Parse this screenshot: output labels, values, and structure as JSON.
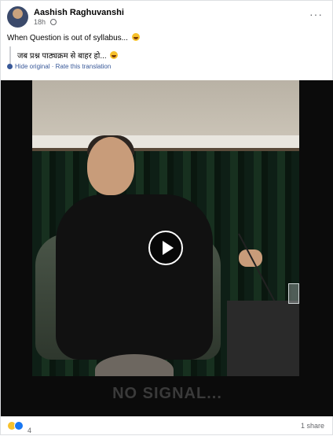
{
  "post": {
    "author": "Aashish Raghuvanshi",
    "time": "18h",
    "privacy_icon": "globe-icon",
    "more_icon": "more-horizontal-icon",
    "caption": "When Question is out of syllabus...",
    "caption_emoji": "laughing-emoji-icon"
  },
  "translation": {
    "text": "जब प्रश्न पाठ्यक्रम से बाहर हो...",
    "hide_link": "Hide original",
    "separator": "·",
    "rate_link": "Rate this translation",
    "icon": "translate-gear-icon"
  },
  "video": {
    "overlay_text": "NO SIGNAL...",
    "play_icon": "play-icon"
  },
  "footer": {
    "reaction_count": "4",
    "reaction_icons": [
      "haha-reaction-icon",
      "like-reaction-icon"
    ],
    "shares": "1 share"
  }
}
